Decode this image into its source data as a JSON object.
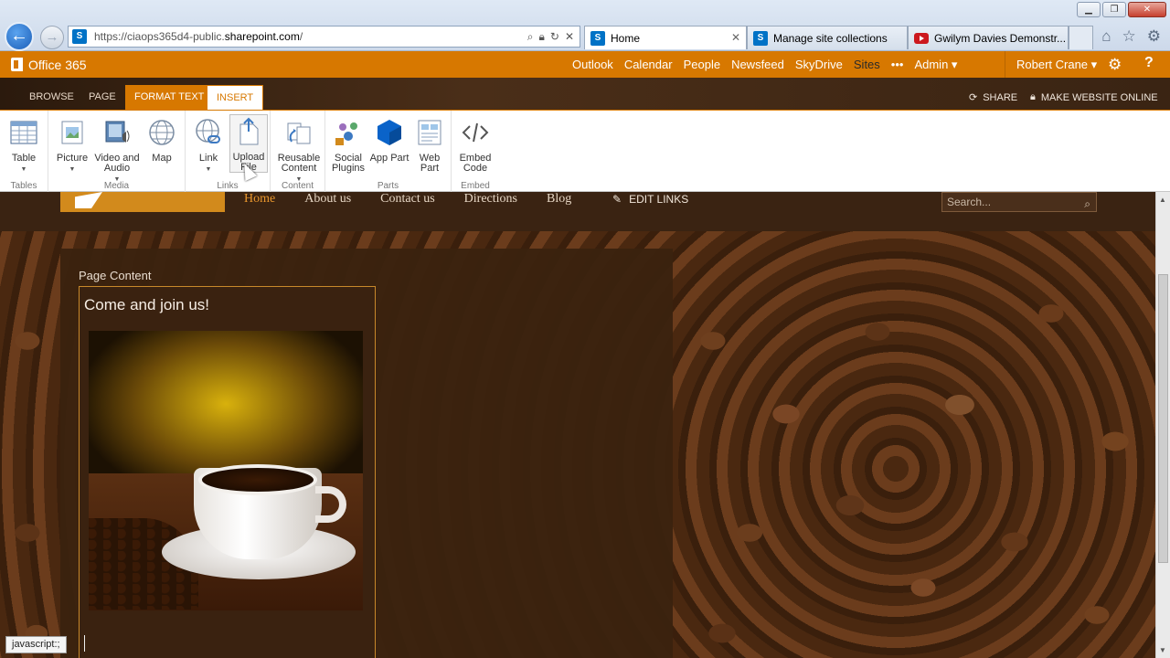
{
  "browser": {
    "url_prefix": "https://ciaops365d4-public.",
    "url_domain": "sharepoint.com",
    "url_suffix": "/",
    "tabs": [
      {
        "label": "Home",
        "active": true
      },
      {
        "label": "Manage site collections",
        "active": false
      },
      {
        "label": "Gwilym Davies Demonstr...",
        "active": false
      }
    ],
    "window_controls": [
      "minimize",
      "restore",
      "close"
    ]
  },
  "suite": {
    "brand": "Office 365",
    "nav": [
      "Outlook",
      "Calendar",
      "People",
      "Newsfeed",
      "SkyDrive",
      "Sites",
      "•••",
      "Admin ▾"
    ],
    "selected": "Sites",
    "user": "Robert Crane ▾",
    "help": "?"
  },
  "ribbon_tabs": {
    "items": [
      "BROWSE",
      "PAGE",
      "FORMAT TEXT",
      "INSERT"
    ],
    "share": "SHARE",
    "make_online": "MAKE WEBSITE ONLINE"
  },
  "ribbon": {
    "groups": [
      {
        "label": "Tables",
        "buttons": [
          {
            "label": "Table",
            "dropdown": true,
            "icon": "table-icon"
          }
        ]
      },
      {
        "label": "Media",
        "buttons": [
          {
            "label": "Picture",
            "dropdown": true,
            "icon": "picture-icon"
          },
          {
            "label": "Video and Audio",
            "dropdown": true,
            "icon": "video-icon"
          },
          {
            "label": "Map",
            "dropdown": false,
            "icon": "globe-icon"
          }
        ]
      },
      {
        "label": "Links",
        "buttons": [
          {
            "label": "Link",
            "dropdown": true,
            "icon": "link-icon"
          },
          {
            "label": "Upload File",
            "dropdown": false,
            "icon": "upload-icon"
          }
        ]
      },
      {
        "label": "Content",
        "buttons": [
          {
            "label": "Reusable Content",
            "dropdown": true,
            "icon": "reusable-content-icon"
          }
        ]
      },
      {
        "label": "Parts",
        "buttons": [
          {
            "label": "Social Plugins",
            "dropdown": false,
            "icon": "social-plugins-icon"
          },
          {
            "label": "App Part",
            "dropdown": false,
            "icon": "app-part-icon"
          },
          {
            "label": "Web Part",
            "dropdown": false,
            "icon": "web-part-icon"
          }
        ]
      },
      {
        "label": "Embed",
        "buttons": [
          {
            "label": "Embed Code",
            "dropdown": false,
            "icon": "embed-code-icon"
          }
        ]
      }
    ]
  },
  "site": {
    "nav": [
      "Home",
      "About us",
      "Contact us",
      "Directions",
      "Blog"
    ],
    "current": "Home",
    "edit_links": "EDIT LINKS",
    "search_placeholder": "Search...",
    "page_content_label": "Page Content",
    "heading": "Come and join us!"
  },
  "status_text": "javascript:;",
  "colors": {
    "suite_bar": "#d77800",
    "nav_current": "#e8962d",
    "site_bg": "#3b2412"
  }
}
